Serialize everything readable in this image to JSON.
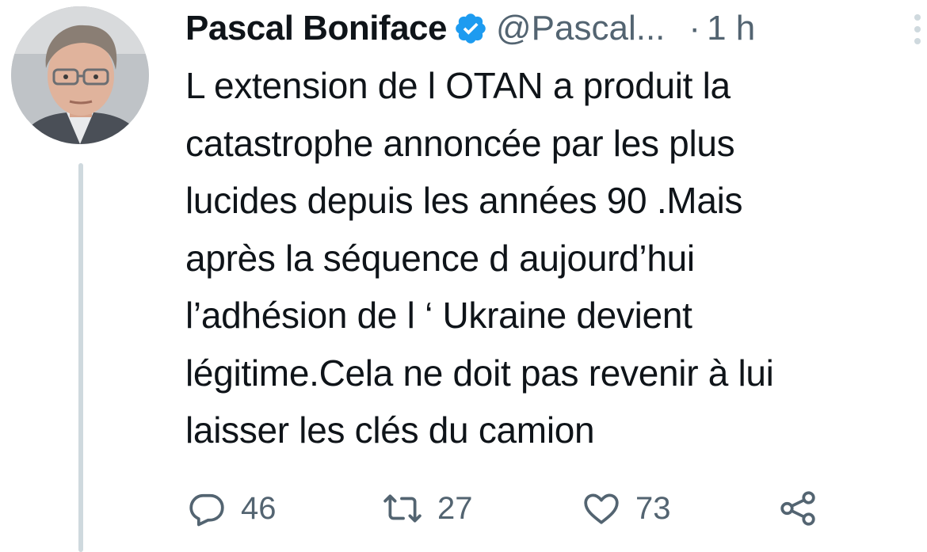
{
  "author": {
    "display_name": "Pascal Boniface",
    "handle": "@Pascal...",
    "verified": true,
    "verified_icon": "verified-badge-icon",
    "verified_color": "#1d9bf0"
  },
  "meta": {
    "separator": "·",
    "time": "1 h"
  },
  "tweet": {
    "text": "L extension de l OTAN a produit  la\ncatastrophe annoncée par les plus\nlucides  depuis les années 90 .Mais\naprès la séquence d aujourd’hui\nl’adhésion de l ‘ Ukraine devient\nlégitime.Cela ne doit pas revenir à lui\nlaisser les clés du camion"
  },
  "actions": {
    "reply": {
      "icon": "reply-icon",
      "count": "46"
    },
    "retweet": {
      "icon": "retweet-icon",
      "count": "27"
    },
    "like": {
      "icon": "heart-icon",
      "count": "73"
    },
    "share": {
      "icon": "share-icon"
    }
  },
  "colors": {
    "text_primary": "#0f1419",
    "text_secondary": "#536471",
    "thread_line": "#cfd9de",
    "accent": "#1d9bf0"
  }
}
